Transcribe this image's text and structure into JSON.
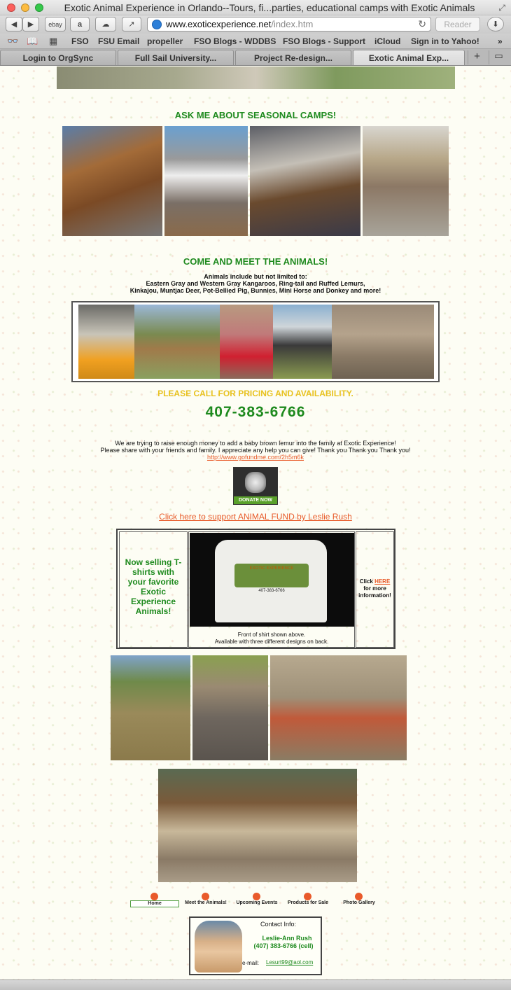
{
  "window": {
    "title": "Exotic Animal Experience in Orlando--Tours, fi...parties, educational camps with Exotic Animals"
  },
  "toolbar": {
    "back_icon": "chevron-left-icon",
    "forward_icon": "chevron-right-icon",
    "ebay_label": "ebay",
    "url_host": "www.exoticexperience.net",
    "url_path": "/index.htm",
    "reader_label": "Reader"
  },
  "bookmarks": [
    "FSO",
    "FSU Email",
    "propeller",
    "FSO Blogs - WDDBS",
    "FSO Blogs - Support",
    "iCloud",
    "Sign in to Yahoo!"
  ],
  "tabs": [
    {
      "label": "Login to OrgSync",
      "active": false
    },
    {
      "label": "Full Sail University...",
      "active": false
    },
    {
      "label": "Project Re-design...",
      "active": false
    },
    {
      "label": "Exotic Animal Exp...",
      "active": true
    }
  ],
  "camps": {
    "heading": "ASK ME ABOUT SEASONAL CAMPS!"
  },
  "meet": {
    "heading": "COME AND MEET THE ANIMALS!",
    "line1": "Animals include but not limited to:",
    "line2": "Eastern Gray and Western Gray Kangaroos, Ring-tail and Ruffed Lemurs,",
    "line3": "Kinkajou, Muntjac Deer, Pot-Bellied Pig, Bunnies, Mini Horse and Donkey and more!"
  },
  "pricing": {
    "text": "PLEASE CALL FOR PRICING AND AVAILABILITY.",
    "phone": "407-383-6766"
  },
  "fundraiser": {
    "line1": "We are trying to raise enough money to add a baby brown lemur into the family at Exotic Experience!",
    "line2": "Please share with your friends and family. I appreciate any help you can give! Thank you Thank you Thank you!",
    "link": "http://www.gofundme.com/2h5m6k",
    "donate_label": "DONATE NOW",
    "animal_fund_link": "Click here to support ANIMAL FUND by Leslie Rush"
  },
  "shirts": {
    "promo": "Now selling T-shirts with your favorite Exotic Experience Animals!",
    "logo_text": "EXOTIC EXPERIENCE",
    "shirt_phone": "407-383-6766",
    "caption1": "Front of shirt shown above.",
    "caption2": "Available with three different designs on back.",
    "click": "Click",
    "here": "HERE",
    "more_info": "for more information!"
  },
  "nav": [
    "Home",
    "Meet the Animals!",
    "Upcoming Events",
    "Products for Sale",
    "Photo Gallery"
  ],
  "contact": {
    "title": "Contact Info:",
    "name": "Leslie-Ann Rush",
    "phone": "(407) 383-6766 (cell)",
    "email_label": "e-mail:",
    "email": "Lesurt99@aol.com"
  },
  "colors": {
    "heading_green": "#1e8a1e",
    "pricing_yellow": "#e8c21f",
    "link_orange": "#e85b2a",
    "nav_dot": "#e95a2b"
  }
}
